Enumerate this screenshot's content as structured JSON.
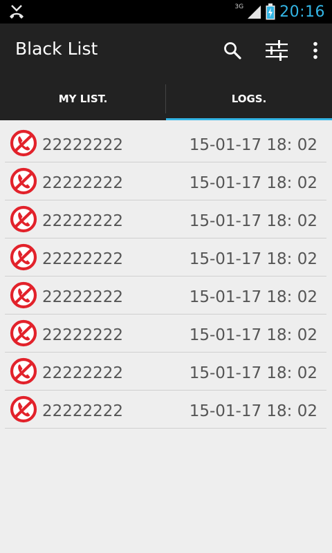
{
  "status_bar": {
    "network": "3G",
    "time": "20:16"
  },
  "app_bar": {
    "title": "Black List"
  },
  "tabs": [
    {
      "label": "MY LIST.",
      "selected": false
    },
    {
      "label": "LOGS.",
      "selected": true
    }
  ],
  "colors": {
    "accent": "#33b5e5",
    "block_icon": "#e2222b",
    "bar_background": "#222222"
  },
  "list": {
    "entries": [
      {
        "number": "22222222",
        "time": "15-01-17 18: 02",
        "icon": "blocked-call-icon"
      },
      {
        "number": "22222222",
        "time": "15-01-17 18: 02",
        "icon": "blocked-call-icon"
      },
      {
        "number": "22222222",
        "time": "15-01-17 18: 02",
        "icon": "blocked-call-icon"
      },
      {
        "number": "22222222",
        "time": "15-01-17 18: 02",
        "icon": "blocked-call-icon"
      },
      {
        "number": "22222222",
        "time": "15-01-17 18: 02",
        "icon": "blocked-call-icon"
      },
      {
        "number": "22222222",
        "time": "15-01-17 18: 02",
        "icon": "blocked-call-icon"
      },
      {
        "number": "22222222",
        "time": "15-01-17 18: 02",
        "icon": "blocked-call-icon"
      },
      {
        "number": "22222222",
        "time": "15-01-17 18: 02",
        "icon": "blocked-call-icon"
      }
    ]
  }
}
